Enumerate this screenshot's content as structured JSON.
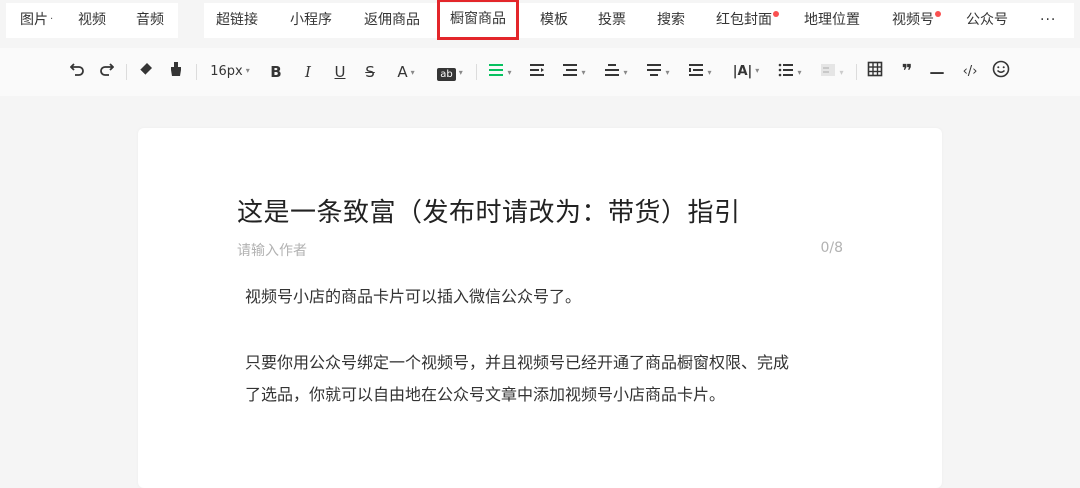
{
  "top_tabs_group1": [
    {
      "label": "图片",
      "caret": "·"
    },
    {
      "label": "视频"
    },
    {
      "label": "音频"
    }
  ],
  "top_tabs_group2": [
    {
      "label": "超链接"
    },
    {
      "label": "小程序"
    },
    {
      "label": "返佣商品"
    },
    {
      "label": "橱窗商品",
      "highlighted": true
    },
    {
      "label": "模板"
    },
    {
      "label": "投票"
    },
    {
      "label": "搜索"
    },
    {
      "label": "红包封面",
      "badge": true
    },
    {
      "label": "地理位置"
    },
    {
      "label": "视频号",
      "badge": true
    },
    {
      "label": "公众号"
    },
    {
      "label": "···"
    }
  ],
  "toolbar": {
    "undo": "undo-icon",
    "redo": "redo-icon",
    "format_brush": "eraser-icon",
    "clear_format": "brush-icon",
    "font_size": "16px",
    "bold": "B",
    "italic": "I",
    "underline": "U",
    "strike": "S",
    "font_color": "A",
    "bg_color": "ab",
    "align": "align-icon",
    "indent": "indent-icon",
    "line_spacing": "line-spacing-icon",
    "paragraph_spacing": "paragraph-spacing-icon",
    "list": "list-icon",
    "table": "table-icon",
    "quote": "❞",
    "divider": "—",
    "code": "‹/›",
    "emoji": "emoji-icon"
  },
  "editor": {
    "title": "这是一条致富（发布时请改为：带货）指引",
    "author_placeholder": "请输入作者",
    "author_counter": "0/8",
    "paragraphs": [
      "视频号小店的商品卡片可以插入微信公众号了。",
      "只要你用公众号绑定一个视频号，并且视频号已经开通了商品橱窗权限、完成",
      "了选品，你就可以自由地在公众号文章中添加视频号小店商品卡片。"
    ]
  },
  "colors": {
    "highlight_border": "#e3262a",
    "badge_dot": "#fa5151",
    "align_active": "#07c160"
  }
}
